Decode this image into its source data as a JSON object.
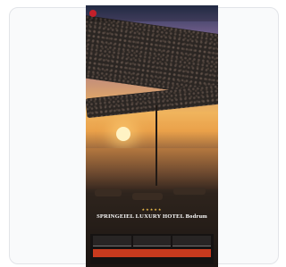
{
  "nav": {
    "links": [
      "",
      "",
      ""
    ],
    "right_links": [
      "",
      ""
    ]
  },
  "hero": {
    "stars": "★★★★★",
    "hotel_name": "SPRINGEIEL LUXURY HOTEL Bodrum",
    "subtitle": ""
  },
  "booking": {
    "fields": [
      {
        "label": "",
        "value": ""
      },
      {
        "label": "",
        "value": ""
      },
      {
        "label": "",
        "value": ""
      }
    ],
    "search_label": ""
  },
  "colors": {
    "brand_red": "#c4202a",
    "cta_orange": "#c83a1e",
    "star_gold": "#f2c14e"
  },
  "icons": {
    "logo": "brand-logo-icon"
  }
}
